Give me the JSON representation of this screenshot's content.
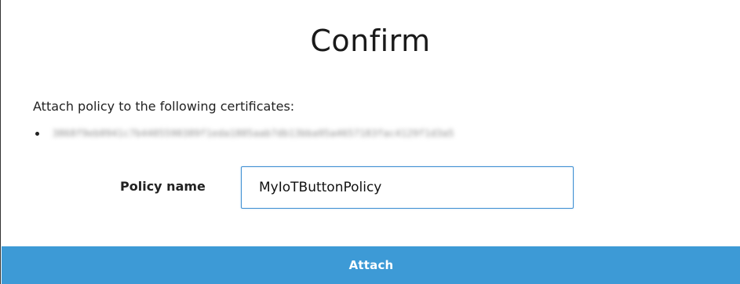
{
  "dialog": {
    "title": "Confirm",
    "description": "Attach policy to the following certificates:",
    "certificates": [
      {
        "id": "3868f9eb0941c7b4405590389f1eda1805aab7db13bba95a4657183fac4129f1d3a5"
      }
    ],
    "policy_field": {
      "label": "Policy name",
      "value": "MyIoTButtonPolicy",
      "placeholder": ""
    },
    "attach_button_label": "Attach"
  },
  "colors": {
    "primary_button": "#3d9ad6",
    "input_focus_border": "#3d8ed2",
    "text": "#222222"
  }
}
